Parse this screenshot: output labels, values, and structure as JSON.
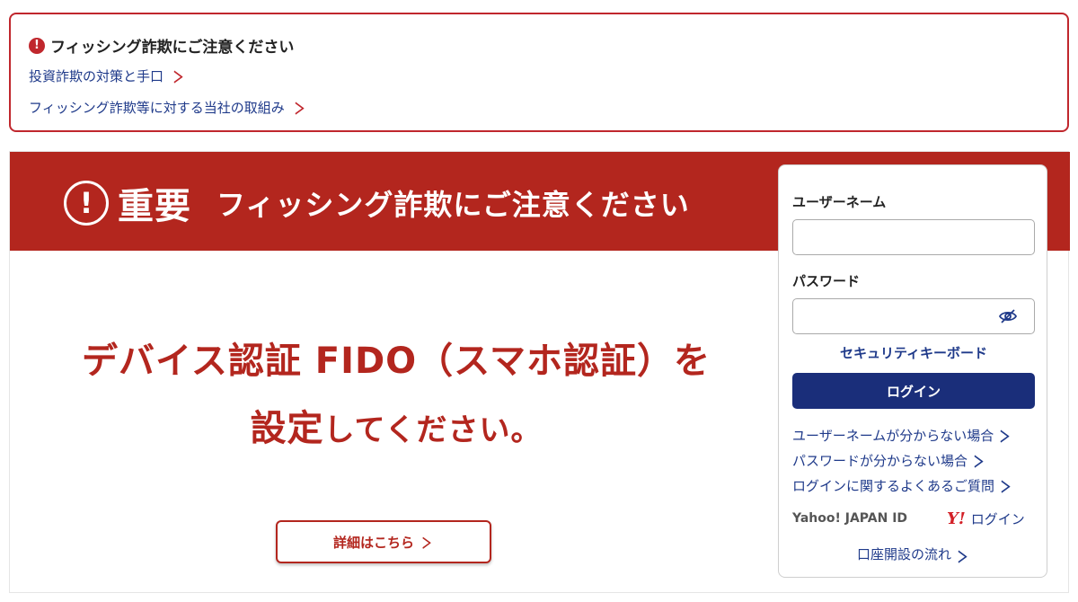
{
  "alert": {
    "title": "フィッシング詐欺にご注意ください",
    "icon": "!",
    "links": [
      {
        "label": "投資詐欺の対策と手口"
      },
      {
        "label": "フィッシング詐欺等に対する当社の取組み"
      }
    ],
    "chevron": "＞"
  },
  "banner": {
    "exclaim": "!",
    "important": "重要",
    "headline": "フィッシング詐欺にご注意ください",
    "line1": "デバイス認証 FIDO（スマホ認証）を",
    "line2_a": "設定",
    "line2_b": "してください。",
    "detail_button": "詳細はこちら",
    "chevron": "＞"
  },
  "login": {
    "username_label": "ユーザーネーム",
    "password_label": "パスワード",
    "security_keyboard": "セキュリティキーボード",
    "login_button": "ログイン",
    "help_links": [
      {
        "label": "ユーザーネームが分からない場合"
      },
      {
        "label": "パスワードが分からない場合"
      },
      {
        "label": "ログインに関するよくあるご質問"
      }
    ],
    "chevron": "＞",
    "yahoo_id_label": "Yahoo! JAPAN ID",
    "yahoo_logo": "Y!",
    "yahoo_login": "ログイン",
    "account_flow": "口座開設の流れ"
  },
  "colors": {
    "brand_red": "#b3261e",
    "alert_red": "#c0272d",
    "navy": "#1a2e7a",
    "link_blue": "#1f3a8a"
  },
  "icons": [
    "alert-icon",
    "exclaim-circle-icon",
    "eye-slash-icon",
    "yahoo-logo-icon",
    "chevron-right-icon"
  ]
}
